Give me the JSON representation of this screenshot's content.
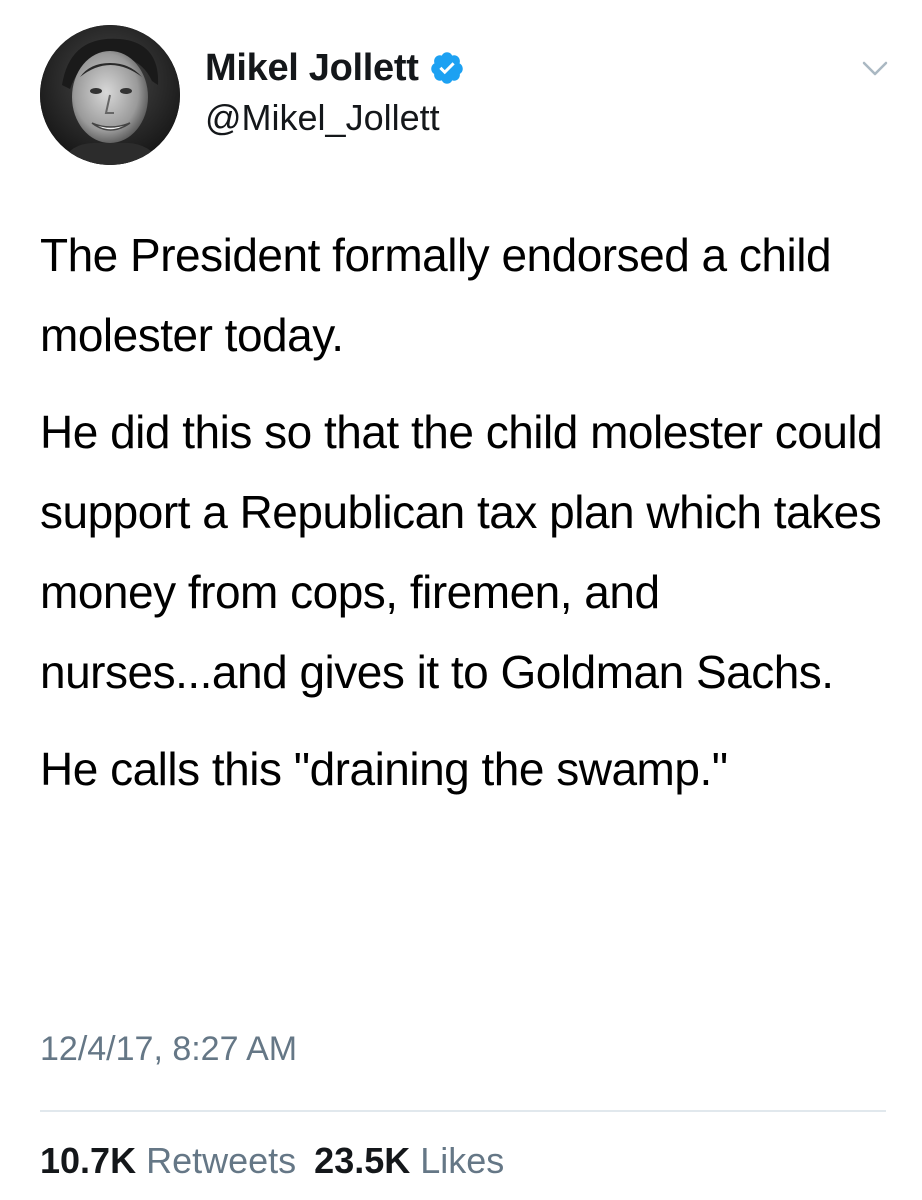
{
  "author": {
    "display_name": "Mikel Jollett",
    "handle": "@Mikel_Jollett",
    "verified": true,
    "avatar_icon": "profile-photo"
  },
  "menu_icon": "chevron-down-icon",
  "tweet": {
    "paragraphs": [
      "The President formally endorsed a child molester today.",
      "He did this so that the child molester could support a Republican tax plan which takes money from cops, firemen, and nurses...and gives it to Goldman Sachs.",
      "He calls this \"draining the swamp.\""
    ],
    "timestamp": "12/4/17, 8:27 AM"
  },
  "stats": {
    "retweets_count": "10.7K",
    "retweets_label": "Retweets",
    "likes_count": "23.5K",
    "likes_label": "Likes"
  },
  "colors": {
    "verified_blue": "#1da1f2",
    "secondary_text": "#657786",
    "divider": "#e1e8ed"
  }
}
